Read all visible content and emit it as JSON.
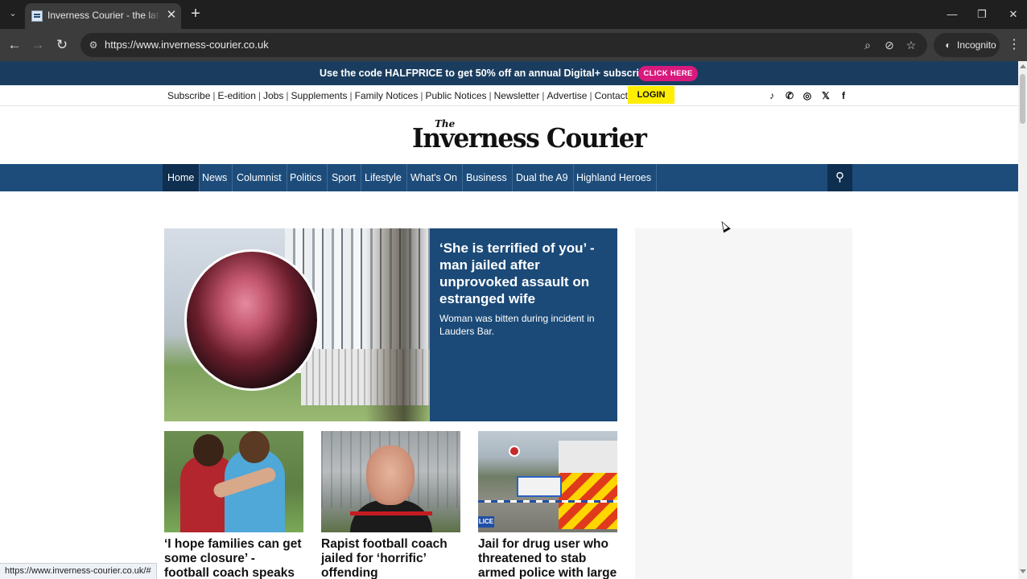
{
  "browser": {
    "tab_title": "Inverness Courier - the latest N",
    "tab_close": "✕",
    "new_tab": "+",
    "tab_list": "⌄",
    "minimize": "—",
    "restore": "❐",
    "close": "✕",
    "back": "←",
    "forward": "→",
    "reload": "↻",
    "site_info_icon": "⚙",
    "url": "https://www.inverness-courier.co.uk",
    "zoom_icon": "⌕",
    "eye_off_icon": "⊘",
    "bookmark_icon": "☆",
    "incognito_label": "Incognito",
    "menu": "⋮",
    "status_url": "https://www.inverness-courier.co.uk/#"
  },
  "promo": {
    "text": "Use the code HALFPRICE to get 50% off an annual Digital+ subscription",
    "button": "CLICK HERE",
    "button_color": "#d8197d",
    "bar_color": "#1a3d5f"
  },
  "utility": {
    "links": [
      "Subscribe",
      "E-edition",
      "Jobs",
      "Supplements",
      "Family Notices",
      "Public Notices",
      "Newsletter",
      "Advertise",
      "Contact"
    ],
    "separator": "|",
    "login": "LOGIN",
    "login_color": "#ffee00",
    "social": [
      "tiktok-icon",
      "whatsapp-icon",
      "instagram-icon",
      "x-icon",
      "facebook-icon"
    ],
    "social_glyphs": [
      "♪",
      "✆",
      "◎",
      "𝕏",
      "f"
    ]
  },
  "masthead": {
    "logo_the": "The",
    "logo_main": "Inverness Courier"
  },
  "nav": {
    "items": [
      "Home",
      "News",
      "Columnist",
      "Politics",
      "Sport",
      "Lifestyle",
      "What's On",
      "Business",
      "Dual the A9",
      "Highland Heroes"
    ],
    "active": "Home",
    "search_icon": "⚲",
    "nav_color": "#1d4c7b"
  },
  "hero": {
    "headline": "‘She is terrified of you’ - man jailed after unprovoked assault on estranged wife",
    "standfirst": "Woman was bitten during incident in Lauders Bar."
  },
  "cards": [
    {
      "title": "‘I hope families can get some closure’ - football coach speaks out after"
    },
    {
      "title": "Rapist football coach jailed for ‘horrific’ offending"
    },
    {
      "title": "Jail for drug user who threatened to stab armed police with large kitchen"
    }
  ],
  "police_badge": "LICE"
}
